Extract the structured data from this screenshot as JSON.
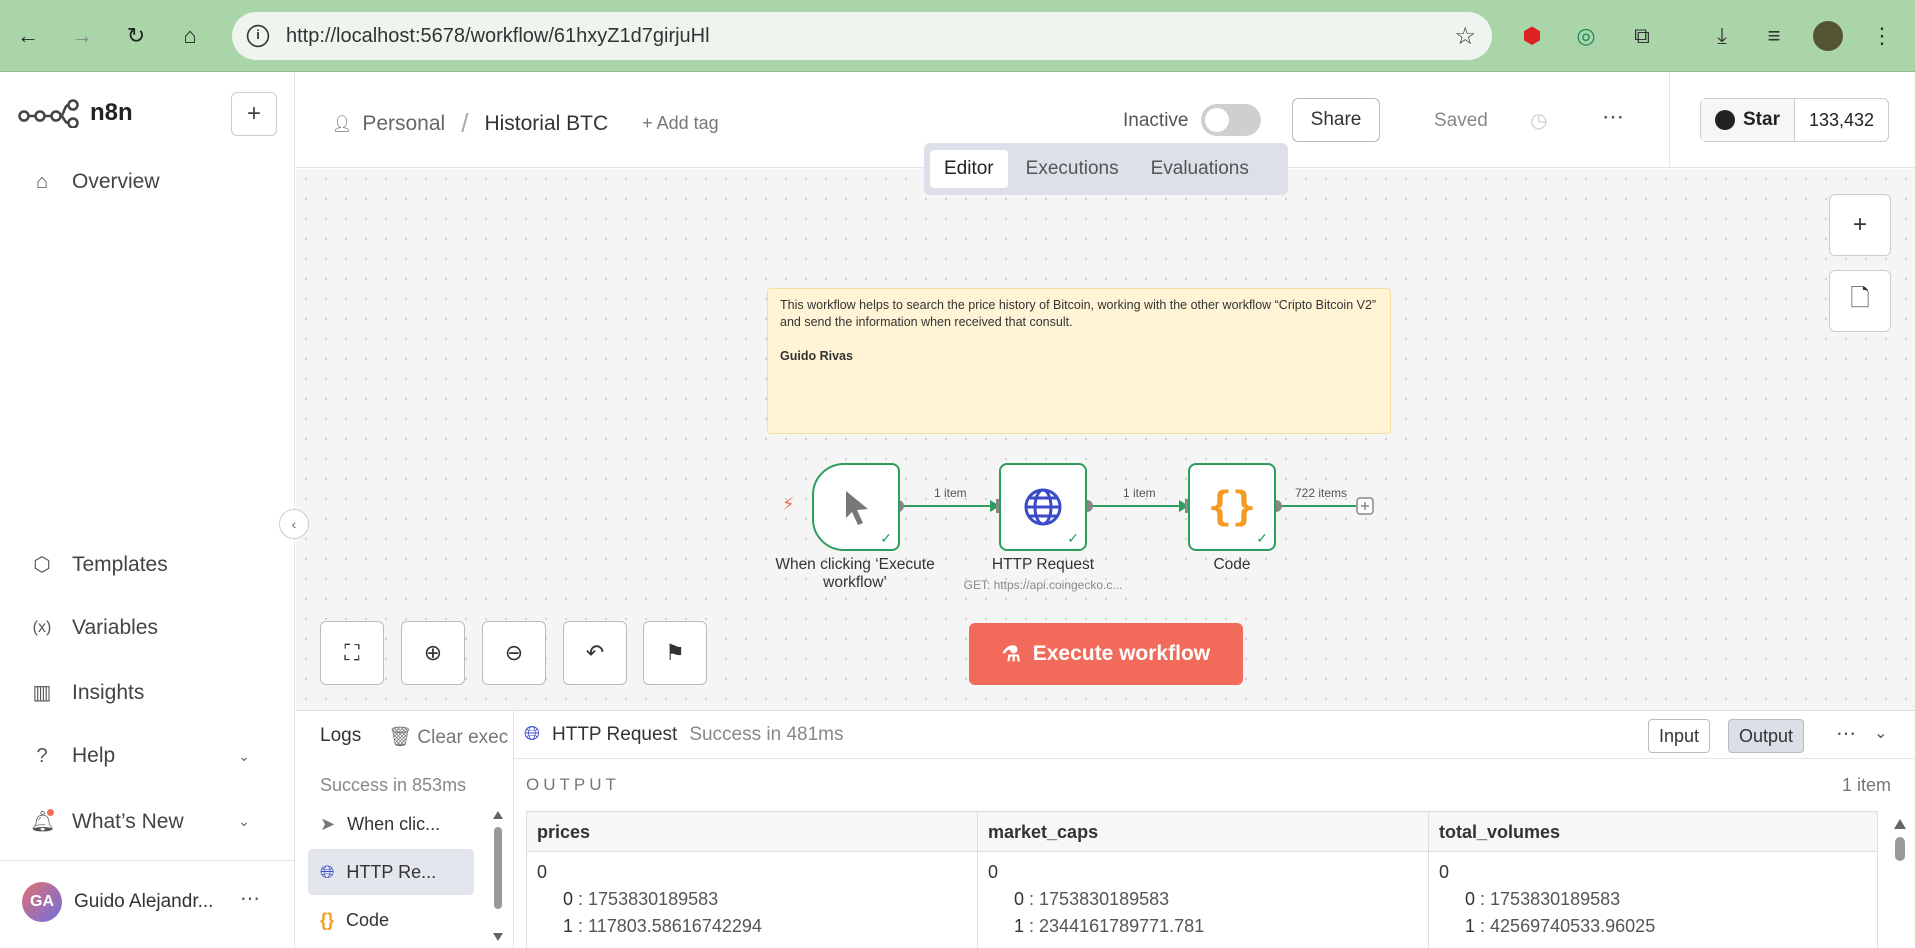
{
  "browser": {
    "url": "http://localhost:5678/workflow/61hxyZ1d7girjuHl"
  },
  "sidebar": {
    "logo_text": "n8n",
    "items": [
      {
        "label": "Overview"
      },
      {
        "label": "Templates"
      },
      {
        "label": "Variables"
      },
      {
        "label": "Insights"
      },
      {
        "label": "Help"
      },
      {
        "label": "What’s New"
      }
    ],
    "user": {
      "initials": "GA",
      "name": "Guido Alejandr..."
    }
  },
  "header": {
    "project": "Personal",
    "workflow_name": "Historial BTC",
    "add_tag": "+ Add tag",
    "status_label": "Inactive",
    "share_label": "Share",
    "saved_label": "Saved",
    "github": {
      "star_label": "Star",
      "count": "133,432"
    },
    "tabs": [
      {
        "label": "Editor",
        "active": true
      },
      {
        "label": "Executions",
        "active": false
      },
      {
        "label": "Evaluations",
        "active": false
      }
    ]
  },
  "canvas": {
    "sticky_note": {
      "text": "This workflow helps to search the price history of Bitcoin, working with the other workflow “Cripto Bitcoin V2” and send the information when received that consult.",
      "author": "Guido Rivas"
    },
    "nodes": [
      {
        "label": "When clicking ‘Execute workflow’",
        "icon": "cursor-icon"
      },
      {
        "label": "HTTP Request",
        "subtitle": "GET: https://api.coingecko.c...",
        "icon": "globe-icon"
      },
      {
        "label": "Code",
        "icon": "code-braces-icon"
      }
    ],
    "edges": [
      {
        "label": "1 item"
      },
      {
        "label": "1 item"
      },
      {
        "label": "722 items"
      }
    ],
    "execute_label": "Execute workflow",
    "colors": {
      "node_border": "#2d9e5c",
      "execute_bg": "#f26b5a",
      "note_bg": "#fff5d6"
    }
  },
  "logs": {
    "title": "Logs",
    "clear_label": "Clear execution",
    "total_status": "Success in 853ms",
    "items": [
      {
        "label": "When clic..."
      },
      {
        "label": "HTTP Re...",
        "selected": true
      },
      {
        "label": "Code"
      }
    ],
    "selected_node": {
      "name": "HTTP Request",
      "status": "Success in 481ms"
    },
    "input_label": "Input",
    "output_label": "Output",
    "output_heading": "OUTPUT",
    "items_count": "1 item",
    "columns": [
      {
        "header": "prices",
        "index": "0",
        "rows": [
          {
            "k": "0",
            "v": "1753830189583"
          },
          {
            "k": "1",
            "v": "117803.58616742294"
          }
        ]
      },
      {
        "header": "market_caps",
        "index": "0",
        "rows": [
          {
            "k": "0",
            "v": "1753830189583"
          },
          {
            "k": "1",
            "v": "2344161789771.781"
          }
        ]
      },
      {
        "header": "total_volumes",
        "index": "0",
        "rows": [
          {
            "k": "0",
            "v": "1753830189583"
          },
          {
            "k": "1",
            "v": "42569740533.96025"
          }
        ]
      }
    ]
  }
}
